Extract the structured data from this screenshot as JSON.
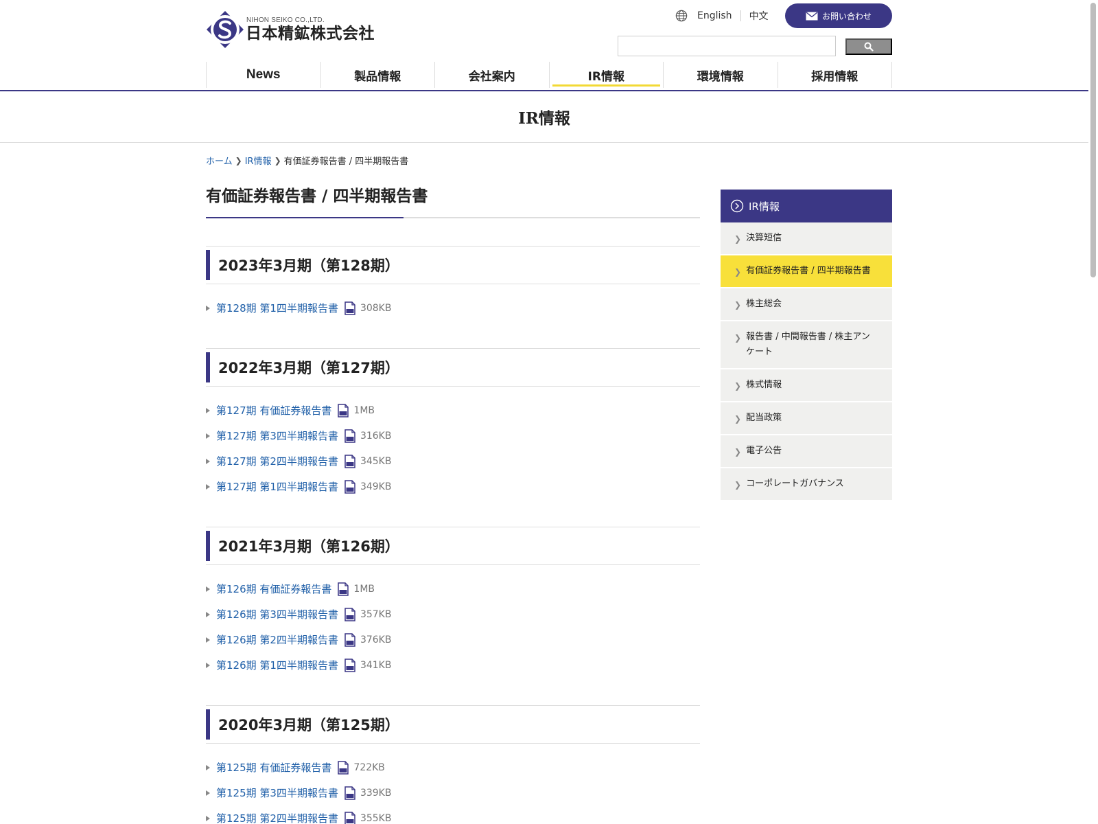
{
  "header": {
    "logo_en": "NIHON SEIKO CO.,LTD.",
    "logo_ja": "日本精鉱株式会社",
    "lang_en": "English",
    "lang_cn": "中文",
    "contact_label": "お問い合わせ",
    "search_placeholder": "",
    "brand_color": "#3b3785",
    "accent_color": "#f2d935"
  },
  "nav": {
    "items": [
      {
        "label": "News"
      },
      {
        "label": "製品情報"
      },
      {
        "label": "会社案内"
      },
      {
        "label": "IR情報",
        "active": true
      },
      {
        "label": "環境情報"
      },
      {
        "label": "採用情報"
      }
    ]
  },
  "page": {
    "title": "IR情報",
    "heading": "有価証券報告書 / 四半期報告書"
  },
  "breadcrumb": {
    "home": "ホーム",
    "ir": "IR情報",
    "current": "有価証券報告書 / 四半期報告書"
  },
  "sections": [
    {
      "title": "2023年3月期（第128期）",
      "docs": [
        {
          "label": "第128期 第1四半期報告書",
          "size": "308KB"
        }
      ]
    },
    {
      "title": "2022年3月期（第127期）",
      "docs": [
        {
          "label": "第127期 有価証券報告書",
          "size": "1MB"
        },
        {
          "label": "第127期 第3四半期報告書",
          "size": "316KB"
        },
        {
          "label": "第127期 第2四半期報告書",
          "size": "345KB"
        },
        {
          "label": "第127期 第1四半期報告書",
          "size": "349KB"
        }
      ]
    },
    {
      "title": "2021年3月期（第126期）",
      "docs": [
        {
          "label": "第126期 有価証券報告書",
          "size": "1MB"
        },
        {
          "label": "第126期 第3四半期報告書",
          "size": "357KB"
        },
        {
          "label": "第126期 第2四半期報告書",
          "size": "376KB"
        },
        {
          "label": "第126期 第1四半期報告書",
          "size": "341KB"
        }
      ]
    },
    {
      "title": "2020年3月期（第125期）",
      "docs": [
        {
          "label": "第125期 有価証券報告書",
          "size": "722KB"
        },
        {
          "label": "第125期 第3四半期報告書",
          "size": "339KB"
        },
        {
          "label": "第125期 第2四半期報告書",
          "size": "355KB"
        }
      ]
    }
  ],
  "sidebar": {
    "head": "IR情報",
    "items": [
      {
        "label": "決算短信"
      },
      {
        "label": "有価証券報告書 / 四半期報告書",
        "active": true
      },
      {
        "label": "株主総会"
      },
      {
        "label": "報告書 / 中間報告書 / 株主アンケート"
      },
      {
        "label": "株式情報"
      },
      {
        "label": "配当政策"
      },
      {
        "label": "電子公告"
      },
      {
        "label": "コーポレートガバナンス"
      }
    ]
  },
  "icons": {
    "globe": "globe-icon",
    "mail": "mail-icon",
    "search": "search-icon",
    "pdf": "pdf-icon",
    "chevron": "chevron-right-icon"
  }
}
